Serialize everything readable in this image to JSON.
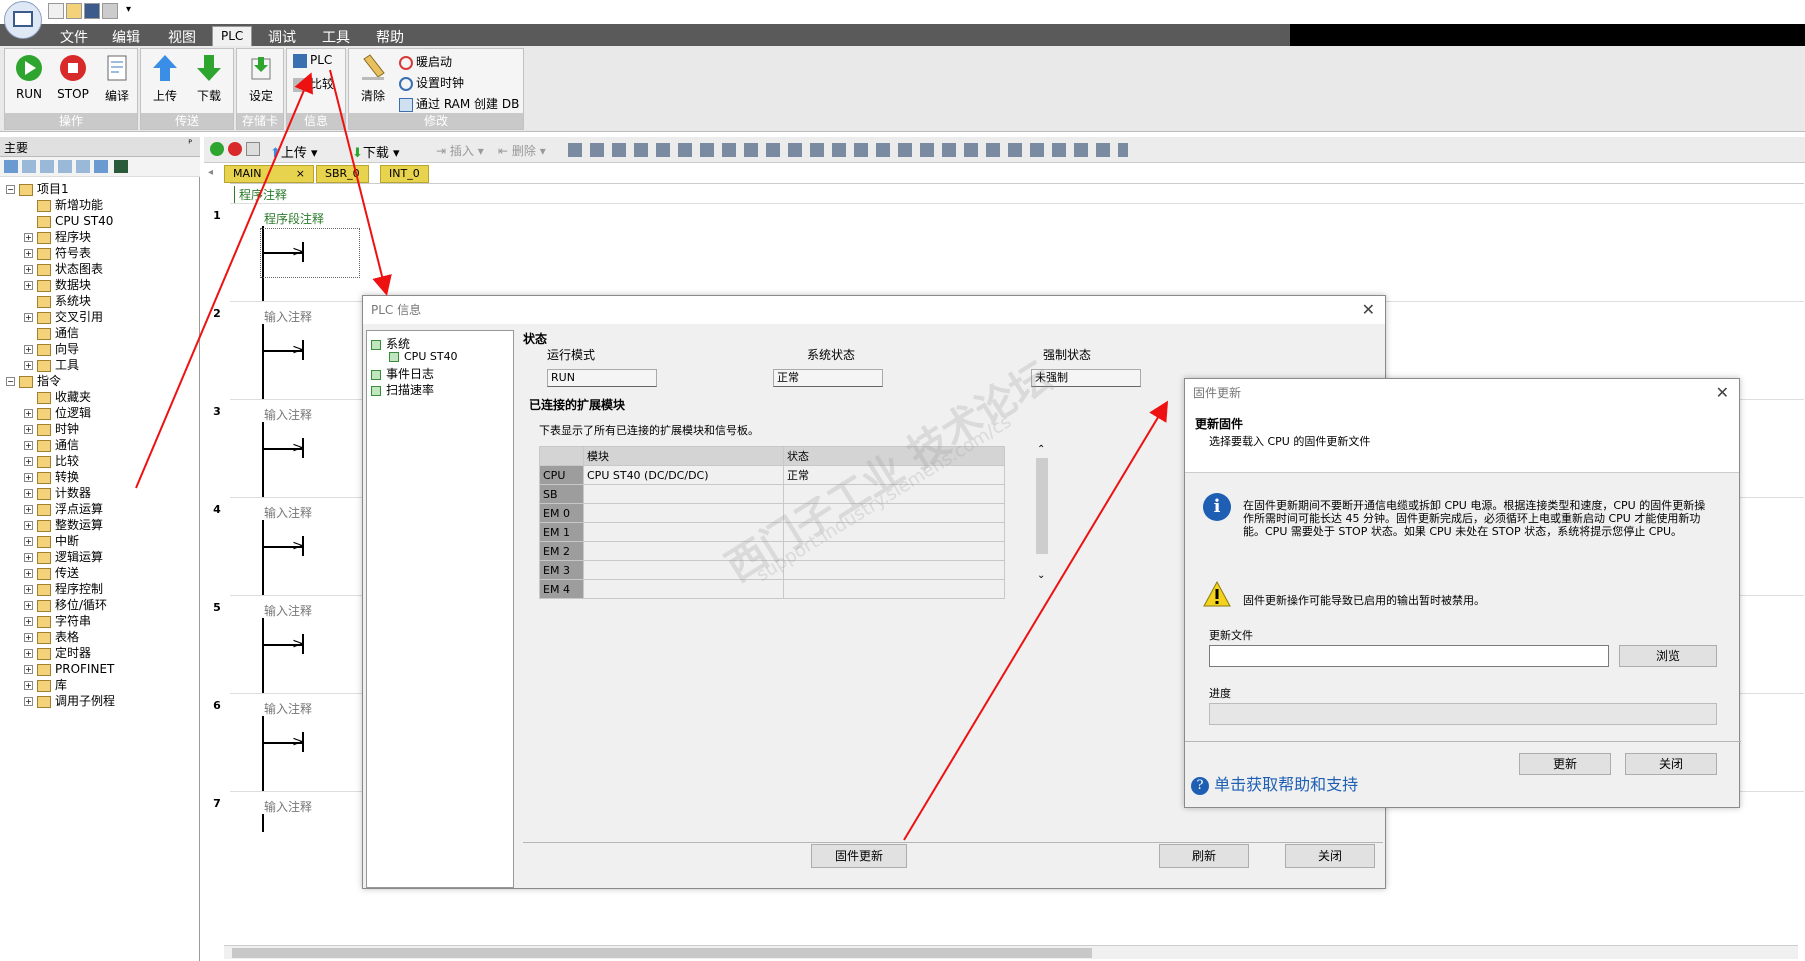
{
  "menu": [
    "文件",
    "编辑",
    "视图",
    "PLC",
    "调试",
    "工具",
    "帮助"
  ],
  "ribbon": {
    "run": "RUN",
    "stop": "STOP",
    "compile": "编译",
    "upload": "上传",
    "download": "下载",
    "settings": "设定",
    "plc_info": "PLC",
    "compare": "比较",
    "clear": "清除",
    "warm_start": "暖启动",
    "set_clock": "设置时钟",
    "create_db": "通过 RAM 创建 DB",
    "groups": [
      "操作",
      "传送",
      "存储卡",
      "信息",
      "修改"
    ]
  },
  "left_panel": {
    "title": "主要",
    "pin": "ᴾ",
    "tree": [
      {
        "label": "项目1",
        "level": 0,
        "pm": "−"
      },
      {
        "label": "新增功能",
        "level": 1,
        "pm": ""
      },
      {
        "label": "CPU ST40",
        "level": 1,
        "pm": ""
      },
      {
        "label": "程序块",
        "level": 1,
        "pm": "+"
      },
      {
        "label": "符号表",
        "level": 1,
        "pm": "+"
      },
      {
        "label": "状态图表",
        "level": 1,
        "pm": "+"
      },
      {
        "label": "数据块",
        "level": 1,
        "pm": "+"
      },
      {
        "label": "系统块",
        "level": 1,
        "pm": ""
      },
      {
        "label": "交叉引用",
        "level": 1,
        "pm": "+"
      },
      {
        "label": "通信",
        "level": 1,
        "pm": ""
      },
      {
        "label": "向导",
        "level": 1,
        "pm": "+"
      },
      {
        "label": "工具",
        "level": 1,
        "pm": "+"
      },
      {
        "label": "指令",
        "level": 0,
        "pm": "−"
      },
      {
        "label": "收藏夹",
        "level": 1,
        "pm": ""
      },
      {
        "label": "位逻辑",
        "level": 1,
        "pm": "+"
      },
      {
        "label": "时钟",
        "level": 1,
        "pm": "+"
      },
      {
        "label": "通信",
        "level": 1,
        "pm": "+"
      },
      {
        "label": "比较",
        "level": 1,
        "pm": "+"
      },
      {
        "label": "转换",
        "level": 1,
        "pm": "+"
      },
      {
        "label": "计数器",
        "level": 1,
        "pm": "+"
      },
      {
        "label": "浮点运算",
        "level": 1,
        "pm": "+"
      },
      {
        "label": "整数运算",
        "level": 1,
        "pm": "+"
      },
      {
        "label": "中断",
        "level": 1,
        "pm": "+"
      },
      {
        "label": "逻辑运算",
        "level": 1,
        "pm": "+"
      },
      {
        "label": "传送",
        "level": 1,
        "pm": "+"
      },
      {
        "label": "程序控制",
        "level": 1,
        "pm": "+"
      },
      {
        "label": "移位/循环",
        "level": 1,
        "pm": "+"
      },
      {
        "label": "字符串",
        "level": 1,
        "pm": "+"
      },
      {
        "label": "表格",
        "level": 1,
        "pm": "+"
      },
      {
        "label": "定时器",
        "level": 1,
        "pm": "+"
      },
      {
        "label": "PROFINET",
        "level": 1,
        "pm": "+"
      },
      {
        "label": "库",
        "level": 1,
        "pm": "+"
      },
      {
        "label": "调用子例程",
        "level": 1,
        "pm": "+"
      }
    ]
  },
  "editor": {
    "toolbar": {
      "upload": "上传",
      "download": "下载",
      "insert": "插入",
      "delete": "删除"
    },
    "tabs": [
      "MAIN",
      "SBR_0",
      "INT_0"
    ],
    "program_comment": "程序注释",
    "rungs": [
      {
        "num": "1",
        "comment": "程序段注释"
      },
      {
        "num": "2",
        "comment": "输入注释"
      },
      {
        "num": "3",
        "comment": "输入注释"
      },
      {
        "num": "4",
        "comment": "输入注释"
      },
      {
        "num": "5",
        "comment": "输入注释"
      },
      {
        "num": "6",
        "comment": "输入注释"
      },
      {
        "num": "7",
        "comment": "输入注释"
      }
    ]
  },
  "plc_dialog": {
    "title": "PLC 信息",
    "tree": [
      "系统",
      "CPU ST40",
      "事件日志",
      "扫描速率"
    ],
    "status_header": "状态",
    "run_mode_label": "运行模式",
    "run_mode": "RUN",
    "sys_status_label": "系统状态",
    "sys_status": "正常",
    "force_label": "强制状态",
    "force": "未强制",
    "modules_header": "已连接的扩展模块",
    "modules_desc": "下表显示了所有已连接的扩展模块和信号板。",
    "columns": [
      "模块",
      "状态"
    ],
    "rows": [
      {
        "slot": "CPU",
        "module": "CPU ST40 (DC/DC/DC)",
        "status": "正常"
      },
      {
        "slot": "SB",
        "module": "",
        "status": ""
      },
      {
        "slot": "EM 0",
        "module": "",
        "status": ""
      },
      {
        "slot": "EM 1",
        "module": "",
        "status": ""
      },
      {
        "slot": "EM 2",
        "module": "",
        "status": ""
      },
      {
        "slot": "EM 3",
        "module": "",
        "status": ""
      },
      {
        "slot": "EM 4",
        "module": "",
        "status": ""
      }
    ],
    "firmware_button": "固件更新",
    "refresh_button": "刷新",
    "close_button": "关闭"
  },
  "fw_dialog": {
    "title": "固件更新",
    "heading": "更新固件",
    "subheading": "选择要载入 CPU 的固件更新文件",
    "info_text": "在固件更新期间不要断开通信电缆或拆卸 CPU 电源。根据连接类型和速度，CPU 的固件更新操作所需时间可能长达 45 分钟。固件更新完成后，必须循环上电或重新启动 CPU 才能使用新功能。CPU 需要处于 STOP 状态。如果 CPU 未处在 STOP 状态，系统将提示您停止 CPU。",
    "warning_text": "固件更新操作可能导致已启用的输出暂时被禁用。",
    "file_label": "更新文件",
    "file_value": "",
    "browse_button": "浏览",
    "progress_label": "进度",
    "progress": 0,
    "update_button": "更新",
    "close_button": "关闭",
    "help_link": "单击获取帮助和支持"
  },
  "watermark": {
    "text": "西门子工业 技术论坛",
    "url": "support.industry.siemens.com/cs"
  },
  "colors": {
    "accent_arrow": "#ee1111",
    "tab_yellow": "#e8d34f",
    "menubar": "#5a5a5a"
  }
}
